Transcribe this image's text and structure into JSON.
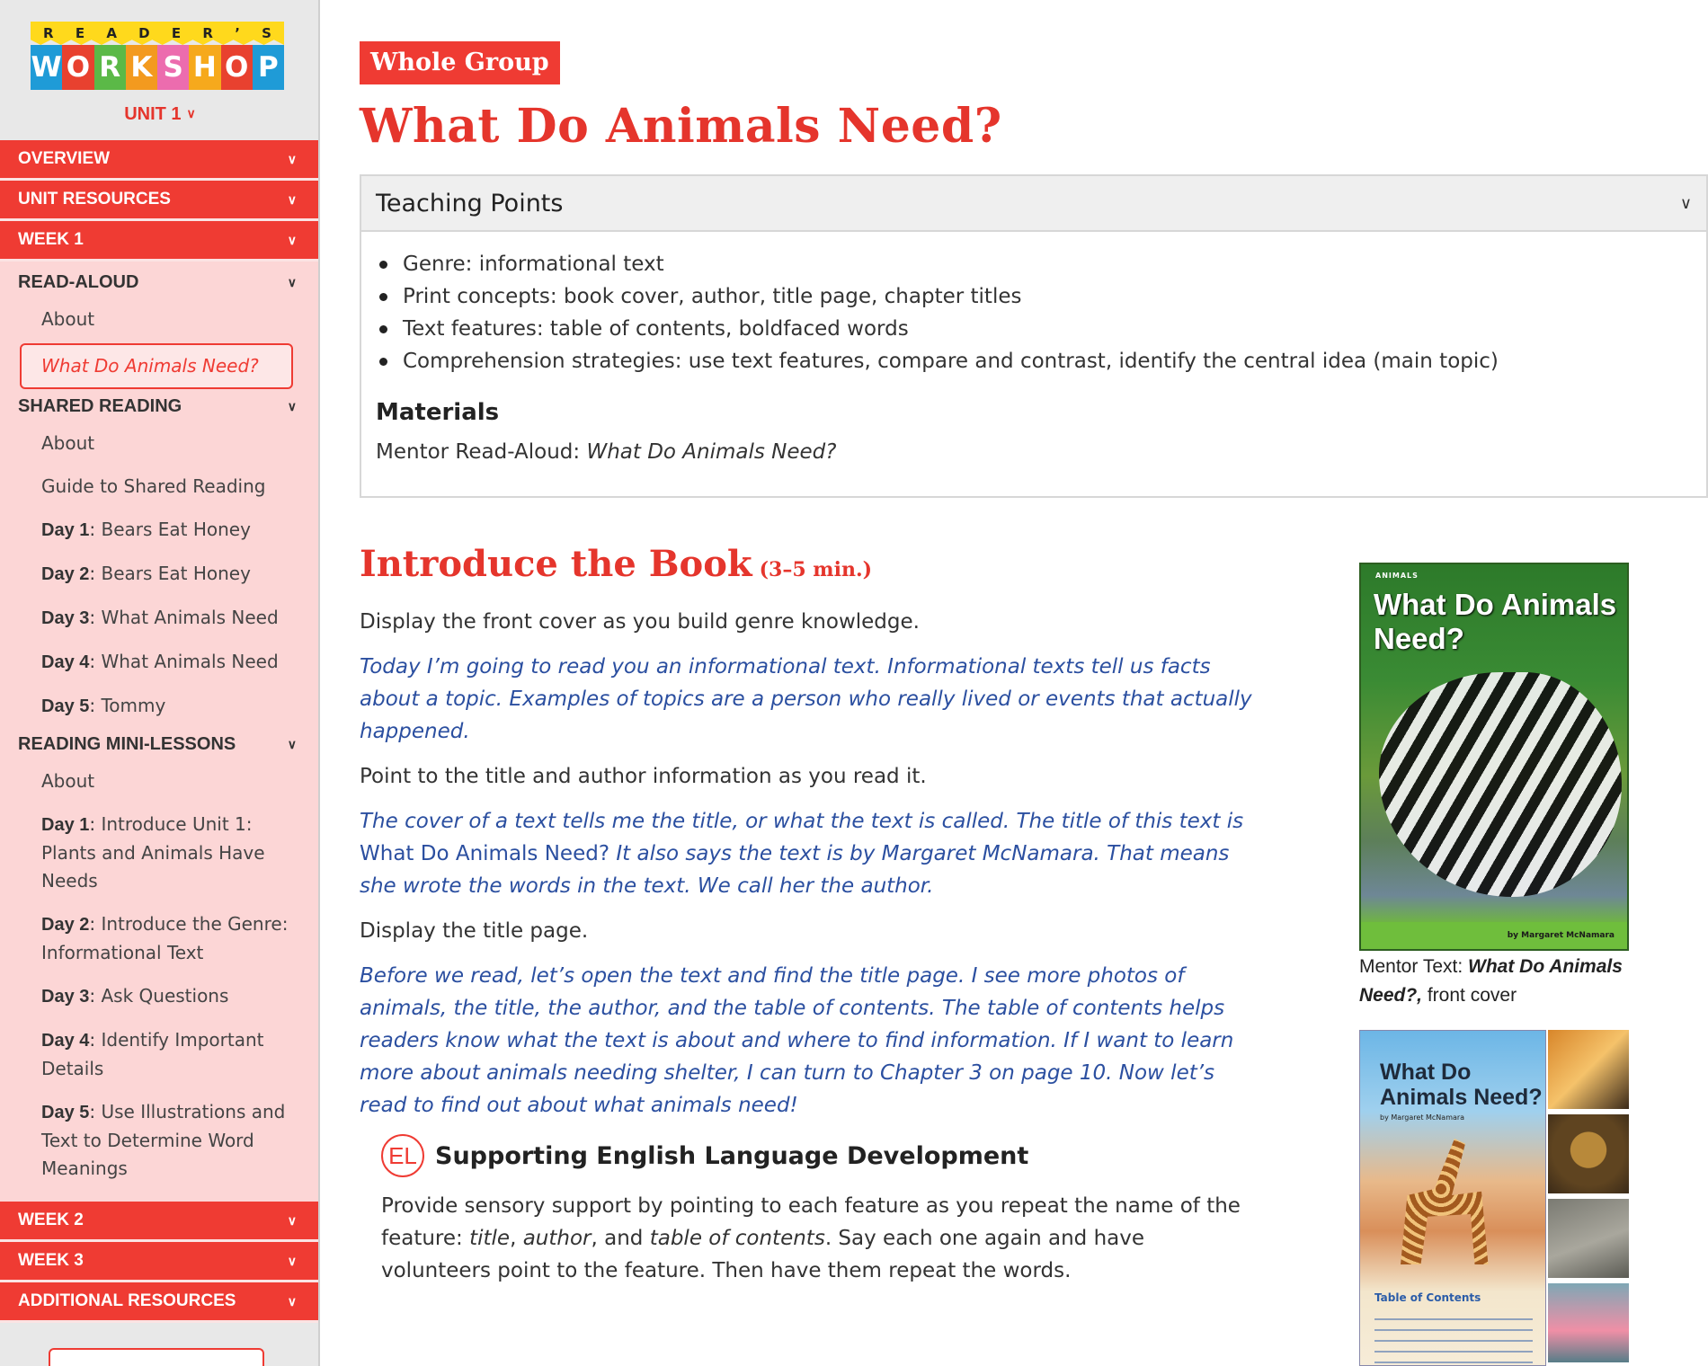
{
  "sidebar": {
    "logo_top_letters": [
      "R",
      "E",
      "A",
      "D",
      "E",
      "R",
      "’",
      "S"
    ],
    "logo_bottom_letters": [
      "W",
      "O",
      "R",
      "K",
      "S",
      "H",
      "O",
      "P"
    ],
    "logo_bottom_colors": [
      "#1f9bd7",
      "#e8412f",
      "#5bb947",
      "#f39a1f",
      "#ec6cae",
      "#f6a91c",
      "#e8412f",
      "#1f9bd7"
    ],
    "unit_label": "UNIT 1",
    "bands_top": [
      "OVERVIEW",
      "UNIT RESOURCES",
      "WEEK 1"
    ],
    "read_aloud": {
      "heading": "READ-ALOUD",
      "items": [
        "About"
      ],
      "active_item": "What Do Animals Need?"
    },
    "shared_reading": {
      "heading": "SHARED READING",
      "items": [
        {
          "day": "",
          "text": "About"
        },
        {
          "day": "",
          "text": "Guide to Shared Reading"
        },
        {
          "day": "Day 1",
          "text": "Bears Eat Honey"
        },
        {
          "day": "Day 2",
          "text": "Bears Eat Honey"
        },
        {
          "day": "Day 3",
          "text": "What Animals Need"
        },
        {
          "day": "Day 4",
          "text": "What Animals Need"
        },
        {
          "day": "Day 5",
          "text": "Tommy"
        }
      ]
    },
    "mini_lessons": {
      "heading": "READING MINI-LESSONS",
      "items": [
        {
          "day": "",
          "text": "About"
        },
        {
          "day": "Day 1",
          "text": "Introduce Unit 1: Plants and Animals Have Needs"
        },
        {
          "day": "Day 2",
          "text": "Introduce the Genre: Informational Text"
        },
        {
          "day": "Day 3",
          "text": "Ask Questions"
        },
        {
          "day": "Day 4",
          "text": "Identify Important Details"
        },
        {
          "day": "Day 5",
          "text": "Use Illustrations and Text to Determine Word Meanings"
        }
      ]
    },
    "bands_bottom": [
      "WEEK 2",
      "WEEK 3",
      "ADDITIONAL RESOURCES"
    ]
  },
  "main": {
    "badge": "Whole Group",
    "title": "What Do Animals Need?",
    "teaching_points": {
      "heading": "Teaching Points",
      "items": [
        "Genre: informational text",
        "Print concepts: book cover, author, title page, chapter titles",
        "Text features: table of contents, boldfaced words",
        "Comprehension strategies: use text features, compare and contrast, identify the central idea (main topic)"
      ],
      "materials_heading": "Materials",
      "materials_label": "Mentor Read-Aloud: ",
      "materials_title": "What Do Animals Need?"
    },
    "intro": {
      "title": "Introduce the Book",
      "duration": "(3–5 min.)",
      "p1": "Display the front cover as you build genre knowledge.",
      "s1": "Today I’m going to read you an informational text. Informational texts tell us facts about a topic. Examples of topics are a person who really lived or events that actually happened.",
      "p2": "Point to the title and author information as you read it.",
      "s2_a": "The cover of a text tells me the title, or what the text is called. The title of this text is ",
      "s2_b": "What Do Animals Need?",
      "s2_c": " It also says the text is by Margaret McNamara. That means she wrote the words in the text. We call her the author.",
      "p3": "Display the title page.",
      "s3": "Before we read, let’s open the text and find the title page. I see more photos of animals, the title, the author, and the table of contents. The table of contents helps readers know what the text is about and where to find information. If I want to learn more about animals needing shelter, I can turn to Chapter 3 on page 10. Now let’s read to find out about what animals need!"
    },
    "el": {
      "badge": "EL",
      "heading": "Supporting English Language Development",
      "t1": "Provide sensory support by pointing to each feature as you repeat the name of the feature: ",
      "i1": "title",
      "t2": ", ",
      "i2": "author",
      "t3": ", and ",
      "i3": "table of contents",
      "t4": ". Say each one again and have volunteers point to the feature. Then have them repeat the words."
    },
    "book_cover": {
      "series": "ANIMALS",
      "title": "What Do Animals Need?",
      "author": "by Margaret McNamara",
      "caption_label": "Mentor Text: ",
      "caption_title": "What Do Animals Need?,",
      "caption_rest": " front cover"
    },
    "title_page": {
      "title": "What Do Animals Need?",
      "by": "by Margaret McNamara",
      "toc": "Table of Contents"
    }
  }
}
